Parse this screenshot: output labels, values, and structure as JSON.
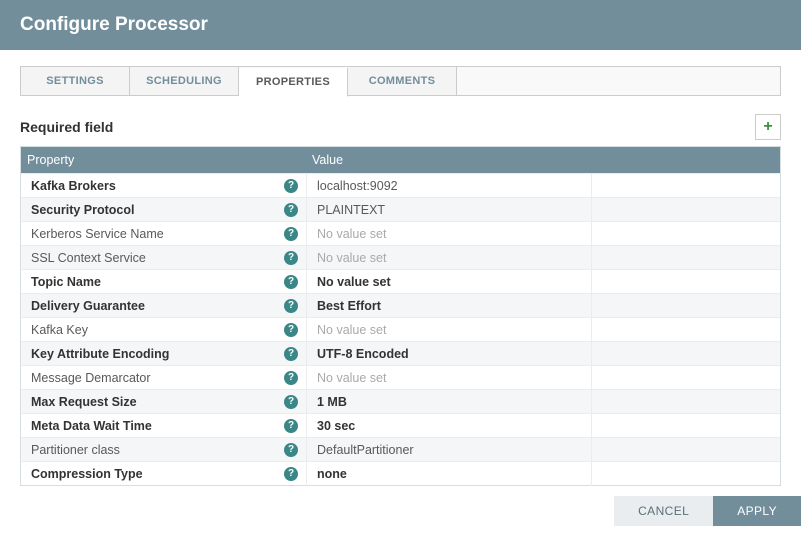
{
  "dialog": {
    "title": "Configure Processor"
  },
  "tabs": {
    "settings": "SETTINGS",
    "scheduling": "SCHEDULING",
    "properties": "PROPERTIES",
    "comments": "COMMENTS"
  },
  "required_label": "Required field",
  "table": {
    "header_property": "Property",
    "header_value": "Value",
    "rows": [
      {
        "name": "Kafka Brokers",
        "value": "localhost:9092",
        "required": true,
        "novalue": false
      },
      {
        "name": "Security Protocol",
        "value": "PLAINTEXT",
        "required": true,
        "novalue": false
      },
      {
        "name": "Kerberos Service Name",
        "value": "No value set",
        "required": false,
        "novalue": true
      },
      {
        "name": "SSL Context Service",
        "value": "No value set",
        "required": false,
        "novalue": true
      },
      {
        "name": "Topic Name",
        "value": "No value set",
        "required": true,
        "novalue": true,
        "valuebold": true
      },
      {
        "name": "Delivery Guarantee",
        "value": "Best Effort",
        "required": true,
        "novalue": false,
        "valuebold": true
      },
      {
        "name": "Kafka Key",
        "value": "No value set",
        "required": false,
        "novalue": true
      },
      {
        "name": "Key Attribute Encoding",
        "value": "UTF-8 Encoded",
        "required": true,
        "novalue": false,
        "valuebold": true
      },
      {
        "name": "Message Demarcator",
        "value": "No value set",
        "required": false,
        "novalue": true
      },
      {
        "name": "Max Request Size",
        "value": "1 MB",
        "required": true,
        "novalue": false,
        "valuebold": true
      },
      {
        "name": "Meta Data Wait Time",
        "value": "30 sec",
        "required": true,
        "novalue": false,
        "valuebold": true
      },
      {
        "name": "Partitioner class",
        "value": "DefaultPartitioner",
        "required": false,
        "novalue": false
      },
      {
        "name": "Compression Type",
        "value": "none",
        "required": true,
        "novalue": false,
        "valuebold": true
      }
    ]
  },
  "buttons": {
    "cancel": "CANCEL",
    "apply": "APPLY"
  },
  "icons": {
    "add": "+",
    "help": "?"
  }
}
